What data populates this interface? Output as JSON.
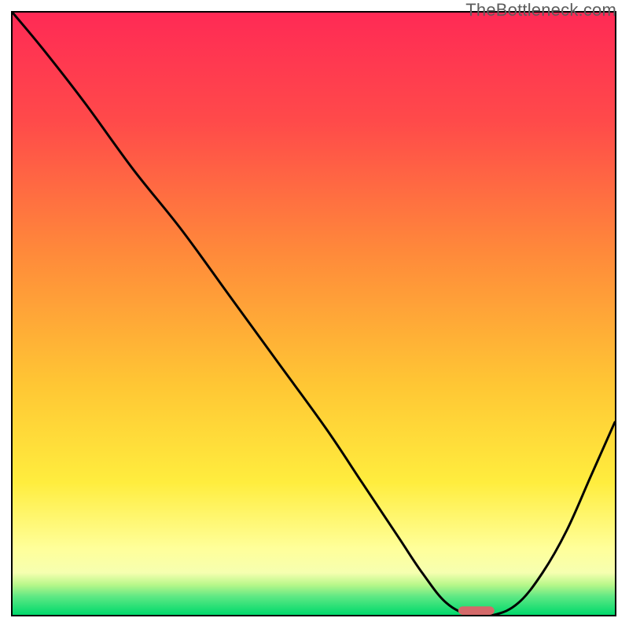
{
  "watermark": "TheBottleneck.com",
  "colors": {
    "gradient_top": "#ff2a55",
    "gradient_mid1": "#ff6a3c",
    "gradient_mid2": "#ffb732",
    "gradient_yellow": "#ffe63e",
    "gradient_pale": "#ffff9a",
    "gradient_green": "#00d96b",
    "curve": "#000000",
    "marker": "#d46a6a",
    "frame_border": "#000000"
  },
  "chart_data": {
    "type": "line",
    "title": "",
    "xlabel": "",
    "ylabel": "",
    "xlim": [
      0,
      100
    ],
    "ylim": [
      0,
      100
    ],
    "series": [
      {
        "name": "bottleneck-curve",
        "x": [
          0,
          5,
          12,
          20,
          28,
          36,
          44,
          52,
          58,
          64,
          68,
          72,
          76,
          80,
          84,
          88,
          92,
          96,
          100
        ],
        "y": [
          100,
          94,
          85,
          74,
          64,
          53,
          42,
          31,
          22,
          13,
          7,
          2,
          0,
          0,
          2,
          7,
          14,
          23,
          32
        ]
      }
    ],
    "markers": [
      {
        "name": "optimum-marker",
        "x": 77,
        "y": 0,
        "width_pct": 6,
        "height_pct": 1.4
      }
    ],
    "gradient_stops_pct": [
      {
        "offset": 0,
        "color": "#ff2a55"
      },
      {
        "offset": 18,
        "color": "#ff4a4a"
      },
      {
        "offset": 40,
        "color": "#ff8a3a"
      },
      {
        "offset": 62,
        "color": "#ffc734"
      },
      {
        "offset": 78,
        "color": "#ffed3e"
      },
      {
        "offset": 89,
        "color": "#ffff9a"
      },
      {
        "offset": 93,
        "color": "#f6ffb0"
      },
      {
        "offset": 95,
        "color": "#b8f78a"
      },
      {
        "offset": 97,
        "color": "#5de884"
      },
      {
        "offset": 100,
        "color": "#00d96b"
      }
    ]
  }
}
